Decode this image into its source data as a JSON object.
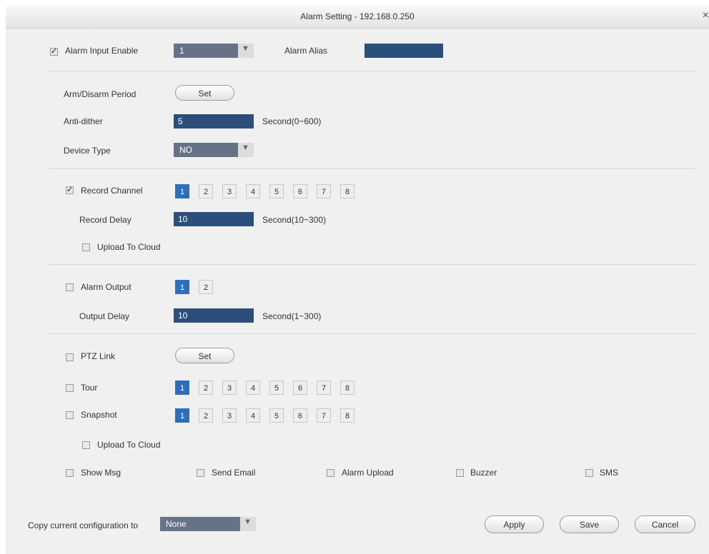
{
  "window": {
    "title": "Alarm Setting - 192.168.0.250",
    "close_glyph": "×"
  },
  "alarm_input": {
    "label": "Alarm Input Enable",
    "checked": true,
    "selected": "1",
    "alias_label": "Alarm Alias",
    "alias_value": ""
  },
  "arm_disarm": {
    "label": "Arm/Disarm Period",
    "button": "Set"
  },
  "anti_dither": {
    "label": "Anti-dither",
    "value": "5",
    "unit": "Second(0~600)"
  },
  "device_type": {
    "label": "Device Type",
    "selected": "NO"
  },
  "record_channel": {
    "label": "Record Channel",
    "checked": true,
    "channels": [
      "1",
      "2",
      "3",
      "4",
      "5",
      "6",
      "7",
      "8"
    ],
    "selected_channel": "1"
  },
  "record_delay": {
    "label": "Record Delay",
    "value": "10",
    "unit": "Second(10~300)"
  },
  "record_upload": {
    "label": "Upload To Cloud",
    "checked": false
  },
  "alarm_output": {
    "label": "Alarm Output",
    "checked": false,
    "channels": [
      "1",
      "2"
    ],
    "selected_channel": "1"
  },
  "output_delay": {
    "label": "Output Delay",
    "value": "10",
    "unit": "Second(1~300)"
  },
  "ptz_link": {
    "label": "PTZ Link",
    "checked": false,
    "button": "Set"
  },
  "tour": {
    "label": "Tour",
    "checked": false,
    "channels": [
      "1",
      "2",
      "3",
      "4",
      "5",
      "6",
      "7",
      "8"
    ],
    "selected_channel": "1"
  },
  "snapshot": {
    "label": "Snapshot",
    "checked": false,
    "channels": [
      "1",
      "2",
      "3",
      "4",
      "5",
      "6",
      "7",
      "8"
    ],
    "selected_channel": "1"
  },
  "snapshot_upload": {
    "label": "Upload To Cloud",
    "checked": false
  },
  "options": {
    "show_msg": "Show Msg",
    "send_email": "Send Email",
    "alarm_upload": "Alarm Upload",
    "buzzer": "Buzzer",
    "sms": "SMS"
  },
  "footer": {
    "copy_label": "Copy current configuration to",
    "copy_selected": "None",
    "apply": "Apply",
    "save": "Save",
    "cancel": "Cancel"
  },
  "colors": {
    "selected_channel": "#2e6eb8",
    "field_bg": "#2b4f7a",
    "select_bg": "#667387"
  },
  "icons": {
    "checkbox_check": "check-icon",
    "dropdown": "chevron-down-icon",
    "close": "close-icon"
  }
}
